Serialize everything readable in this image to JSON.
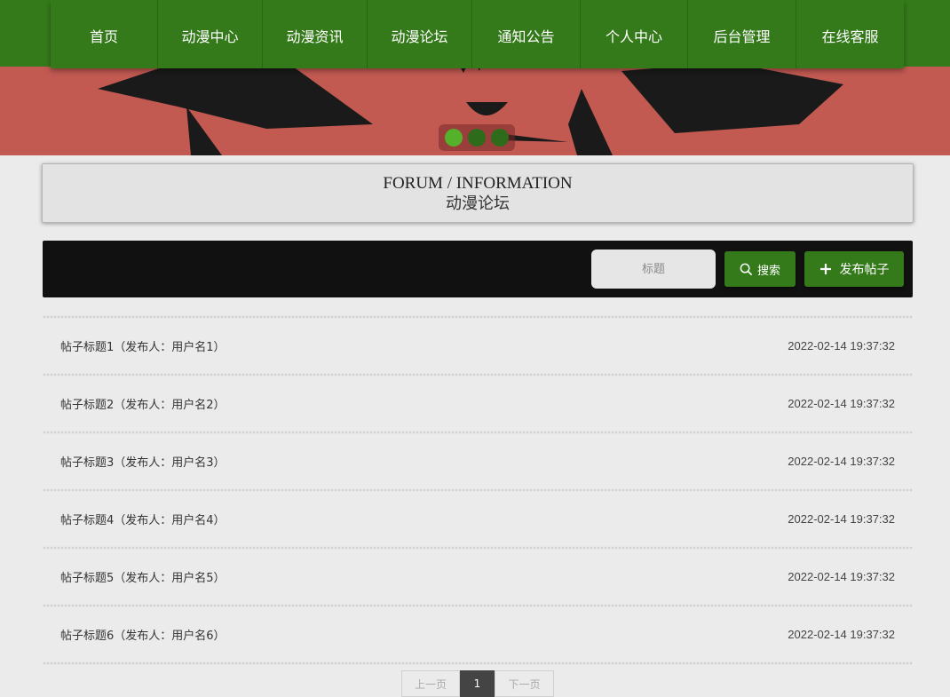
{
  "nav": {
    "items": [
      "首页",
      "动漫中心",
      "动漫资讯",
      "动漫论坛",
      "通知公告",
      "个人中心",
      "后台管理",
      "在线客服"
    ]
  },
  "banner": {
    "slides": 3,
    "active_slide": 1
  },
  "section": {
    "title_en": "FORUM / INFORMATION",
    "title_cn": "动漫论坛"
  },
  "toolbar": {
    "search_placeholder": "标题",
    "search_label": "搜索",
    "publish_label": "发布帖子"
  },
  "posts": [
    {
      "title": "帖子标题1（发布人：用户名1）",
      "time": "2022-02-14 19:37:32"
    },
    {
      "title": "帖子标题2（发布人：用户名2）",
      "time": "2022-02-14 19:37:32"
    },
    {
      "title": "帖子标题3（发布人：用户名3）",
      "time": "2022-02-14 19:37:32"
    },
    {
      "title": "帖子标题4（发布人：用户名4）",
      "time": "2022-02-14 19:37:32"
    },
    {
      "title": "帖子标题5（发布人：用户名5）",
      "time": "2022-02-14 19:37:32"
    },
    {
      "title": "帖子标题6（发布人：用户名6）",
      "time": "2022-02-14 19:37:32"
    }
  ],
  "pagination": {
    "prev": "上一页",
    "current": "1",
    "next": "下一页"
  },
  "colors": {
    "nav_green": "#347a1a",
    "banner_red": "#c25a52",
    "toolbar_black": "#111111"
  },
  "icons": [
    "search-icon",
    "plus-icon"
  ]
}
